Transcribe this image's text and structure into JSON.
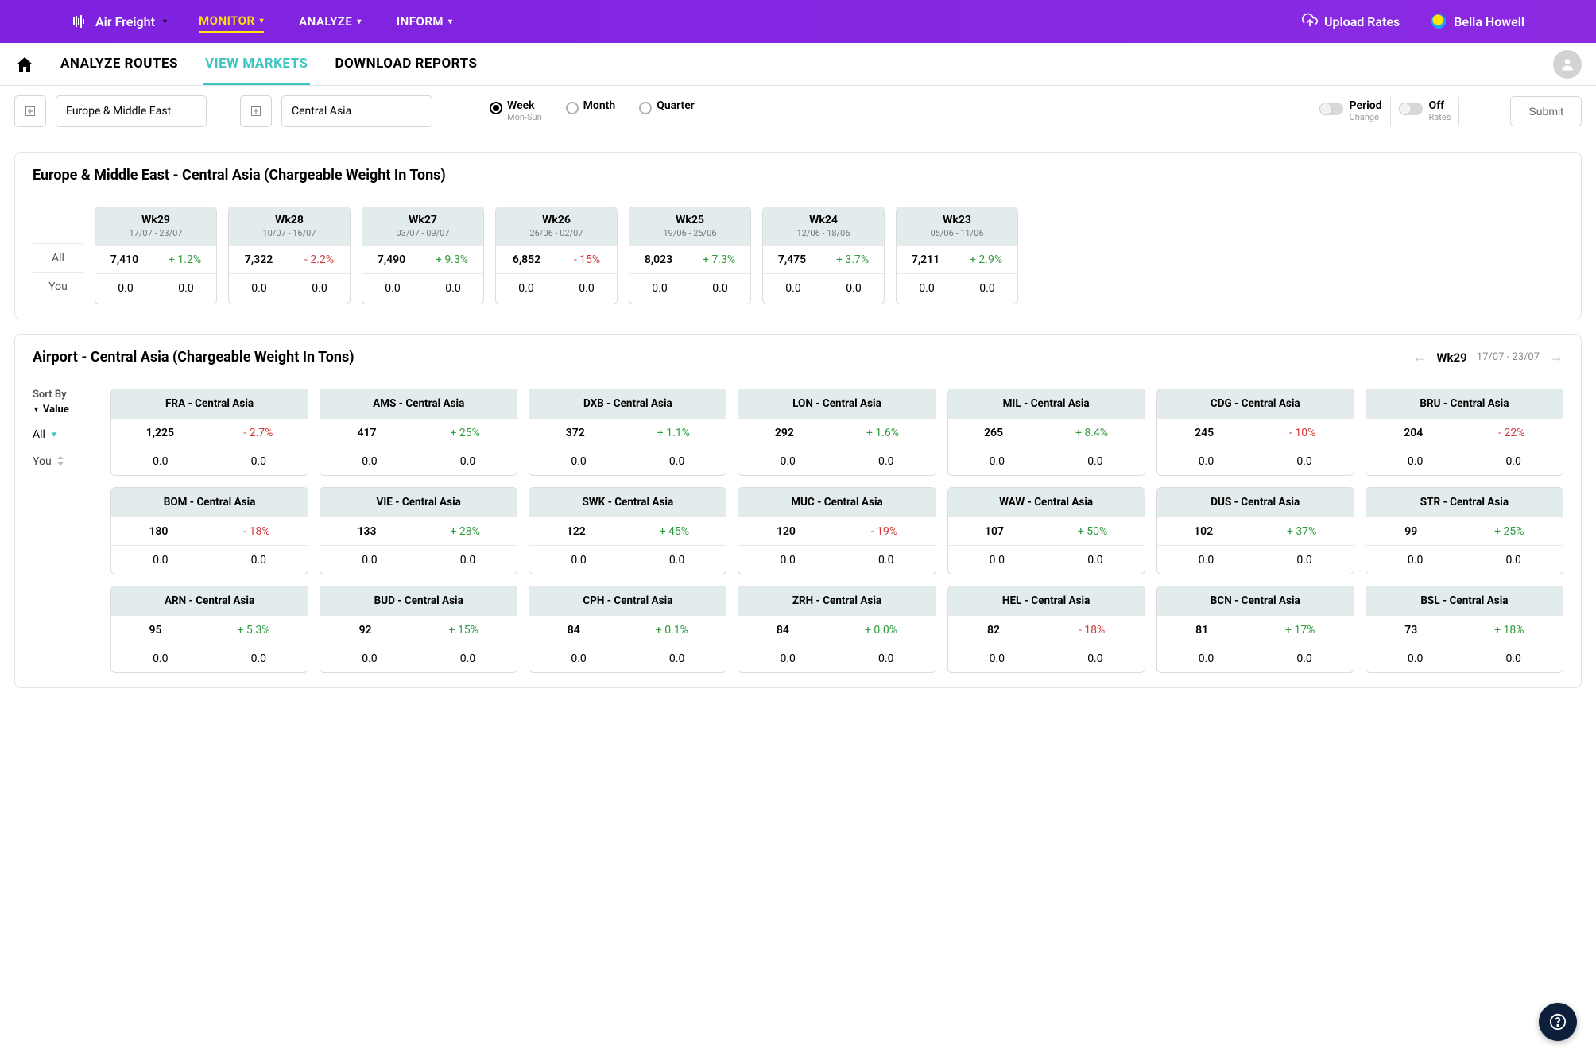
{
  "topnav": {
    "brand": "Air Freight",
    "items": [
      "MONITOR",
      "ANALYZE",
      "INFORM"
    ],
    "active_index": 0,
    "upload_label": "Upload Rates",
    "user_name": "Bella Howell"
  },
  "subnav": {
    "tabs": [
      "ANALYZE ROUTES",
      "VIEW MARKETS",
      "DOWNLOAD REPORTS"
    ],
    "active_index": 1
  },
  "filters": {
    "origin": "Europe & Middle East",
    "destination": "Central Asia",
    "timeframe": {
      "options": [
        {
          "label": "Week",
          "sub": "Mon-Sun",
          "selected": true
        },
        {
          "label": "Month",
          "sub": "",
          "selected": false
        },
        {
          "label": "Quarter",
          "sub": "",
          "selected": false
        }
      ]
    },
    "toggles": [
      {
        "label": "Period",
        "sub": "Change",
        "on": false
      },
      {
        "label": "Off",
        "sub": "Rates",
        "on": false
      }
    ],
    "submit_label": "Submit"
  },
  "weekly": {
    "title": "Europe & Middle East - Central Asia (Chargeable Weight In Tons)",
    "row_labels": [
      "All",
      "You"
    ],
    "weeks": [
      {
        "name": "Wk29",
        "dates": "17/07 - 23/07",
        "all_val": "7,410",
        "all_pct": "+ 1.2%",
        "all_dir": "pos",
        "you_val": "0.0",
        "you_pct": "0.0"
      },
      {
        "name": "Wk28",
        "dates": "10/07 - 16/07",
        "all_val": "7,322",
        "all_pct": "- 2.2%",
        "all_dir": "neg",
        "you_val": "0.0",
        "you_pct": "0.0"
      },
      {
        "name": "Wk27",
        "dates": "03/07 - 09/07",
        "all_val": "7,490",
        "all_pct": "+ 9.3%",
        "all_dir": "pos",
        "you_val": "0.0",
        "you_pct": "0.0"
      },
      {
        "name": "Wk26",
        "dates": "26/06 - 02/07",
        "all_val": "6,852",
        "all_pct": "- 15%",
        "all_dir": "neg",
        "you_val": "0.0",
        "you_pct": "0.0"
      },
      {
        "name": "Wk25",
        "dates": "19/06 - 25/06",
        "all_val": "8,023",
        "all_pct": "+ 7.3%",
        "all_dir": "pos",
        "you_val": "0.0",
        "you_pct": "0.0"
      },
      {
        "name": "Wk24",
        "dates": "12/06 - 18/06",
        "all_val": "7,475",
        "all_pct": "+ 3.7%",
        "all_dir": "pos",
        "you_val": "0.0",
        "you_pct": "0.0"
      },
      {
        "name": "Wk23",
        "dates": "05/06 - 11/06",
        "all_val": "7,211",
        "all_pct": "+ 2.9%",
        "all_dir": "pos",
        "you_val": "0.0",
        "you_pct": "0.0"
      }
    ]
  },
  "airports": {
    "title": "Airport - Central Asia (Chargeable Weight In Tons)",
    "current_week": "Wk29",
    "current_dates": "17/07 - 23/07",
    "sort_label": "Sort By",
    "sort_value": "Value",
    "all_label": "All",
    "you_label": "You",
    "tiles": [
      {
        "name": "FRA - Central Asia",
        "val": "1,225",
        "pct": "- 2.7%",
        "dir": "neg",
        "you_val": "0.0",
        "you_pct": "0.0"
      },
      {
        "name": "AMS - Central Asia",
        "val": "417",
        "pct": "+ 25%",
        "dir": "pos",
        "you_val": "0.0",
        "you_pct": "0.0"
      },
      {
        "name": "DXB - Central Asia",
        "val": "372",
        "pct": "+ 1.1%",
        "dir": "pos",
        "you_val": "0.0",
        "you_pct": "0.0"
      },
      {
        "name": "LON - Central Asia",
        "val": "292",
        "pct": "+ 1.6%",
        "dir": "pos",
        "you_val": "0.0",
        "you_pct": "0.0"
      },
      {
        "name": "MIL - Central Asia",
        "val": "265",
        "pct": "+ 8.4%",
        "dir": "pos",
        "you_val": "0.0",
        "you_pct": "0.0"
      },
      {
        "name": "CDG - Central Asia",
        "val": "245",
        "pct": "- 10%",
        "dir": "neg",
        "you_val": "0.0",
        "you_pct": "0.0"
      },
      {
        "name": "BRU - Central Asia",
        "val": "204",
        "pct": "- 22%",
        "dir": "neg",
        "you_val": "0.0",
        "you_pct": "0.0"
      },
      {
        "name": "BOM - Central Asia",
        "val": "180",
        "pct": "- 18%",
        "dir": "neg",
        "you_val": "0.0",
        "you_pct": "0.0"
      },
      {
        "name": "VIE - Central Asia",
        "val": "133",
        "pct": "+ 28%",
        "dir": "pos",
        "you_val": "0.0",
        "you_pct": "0.0"
      },
      {
        "name": "SWK - Central Asia",
        "val": "122",
        "pct": "+ 45%",
        "dir": "pos",
        "you_val": "0.0",
        "you_pct": "0.0"
      },
      {
        "name": "MUC - Central Asia",
        "val": "120",
        "pct": "- 19%",
        "dir": "neg",
        "you_val": "0.0",
        "you_pct": "0.0"
      },
      {
        "name": "WAW - Central Asia",
        "val": "107",
        "pct": "+ 50%",
        "dir": "pos",
        "you_val": "0.0",
        "you_pct": "0.0"
      },
      {
        "name": "DUS - Central Asia",
        "val": "102",
        "pct": "+ 37%",
        "dir": "pos",
        "you_val": "0.0",
        "you_pct": "0.0"
      },
      {
        "name": "STR - Central Asia",
        "val": "99",
        "pct": "+ 25%",
        "dir": "pos",
        "you_val": "0.0",
        "you_pct": "0.0"
      },
      {
        "name": "ARN - Central Asia",
        "val": "95",
        "pct": "+ 5.3%",
        "dir": "pos",
        "you_val": "0.0",
        "you_pct": "0.0"
      },
      {
        "name": "BUD - Central Asia",
        "val": "92",
        "pct": "+ 15%",
        "dir": "pos",
        "you_val": "0.0",
        "you_pct": "0.0"
      },
      {
        "name": "CPH - Central Asia",
        "val": "84",
        "pct": "+ 0.1%",
        "dir": "pos",
        "you_val": "0.0",
        "you_pct": "0.0"
      },
      {
        "name": "ZRH - Central Asia",
        "val": "84",
        "pct": "+ 0.0%",
        "dir": "pos",
        "you_val": "0.0",
        "you_pct": "0.0"
      },
      {
        "name": "HEL - Central Asia",
        "val": "82",
        "pct": "- 18%",
        "dir": "neg",
        "you_val": "0.0",
        "you_pct": "0.0"
      },
      {
        "name": "BCN - Central Asia",
        "val": "81",
        "pct": "+ 17%",
        "dir": "pos",
        "you_val": "0.0",
        "you_pct": "0.0"
      },
      {
        "name": "BSL - Central Asia",
        "val": "73",
        "pct": "+ 18%",
        "dir": "pos",
        "you_val": "0.0",
        "you_pct": "0.0"
      }
    ]
  }
}
